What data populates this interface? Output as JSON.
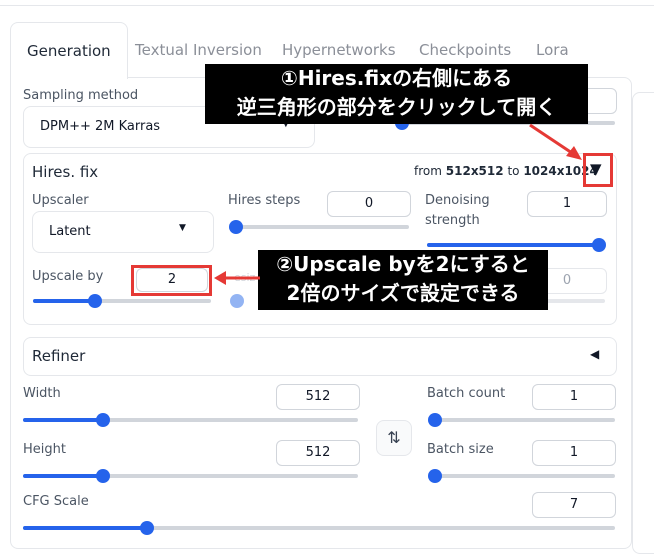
{
  "tabs": [
    "Generation",
    "Textual Inversion",
    "Hypernetworks",
    "Checkpoints",
    "Lora"
  ],
  "sampling": {
    "label": "Sampling method",
    "value": "DPM++ 2M Karras"
  },
  "hires": {
    "title": "Hires. fix",
    "from_label": "from",
    "from_value": "512x512",
    "to_label": "to",
    "to_value": "1024x1024",
    "toggle": "▼",
    "upscaler_label": "Upscaler",
    "upscaler_value": "Latent",
    "steps_label": "Hires steps",
    "steps_value": "0",
    "denoise_label_1": "Denoising",
    "denoise_label_2": "strength",
    "denoise_value": "1",
    "upscale_label": "Upscale by",
    "upscale_value": "2",
    "resize_partial": "esiz",
    "resize_value": "0"
  },
  "refiner": {
    "title": "Refiner",
    "toggle": "◀"
  },
  "width": {
    "label": "Width",
    "value": "512"
  },
  "height": {
    "label": "Height",
    "value": "512"
  },
  "batch_count": {
    "label": "Batch count",
    "value": "1"
  },
  "batch_size": {
    "label": "Batch size",
    "value": "1"
  },
  "cfg": {
    "label": "CFG Scale",
    "value": "7"
  },
  "swap_icon": "⇅",
  "annotations": {
    "top_line1": "①Hires.fixの右側にある",
    "top_line2": "逆三角形の部分をクリックして開く",
    "mid_line1": "②Upscale byを2にすると",
    "mid_line2": "2倍のサイズで設定できる"
  },
  "colors": {
    "accent": "#2563eb",
    "annotation_red": "#e53935"
  }
}
